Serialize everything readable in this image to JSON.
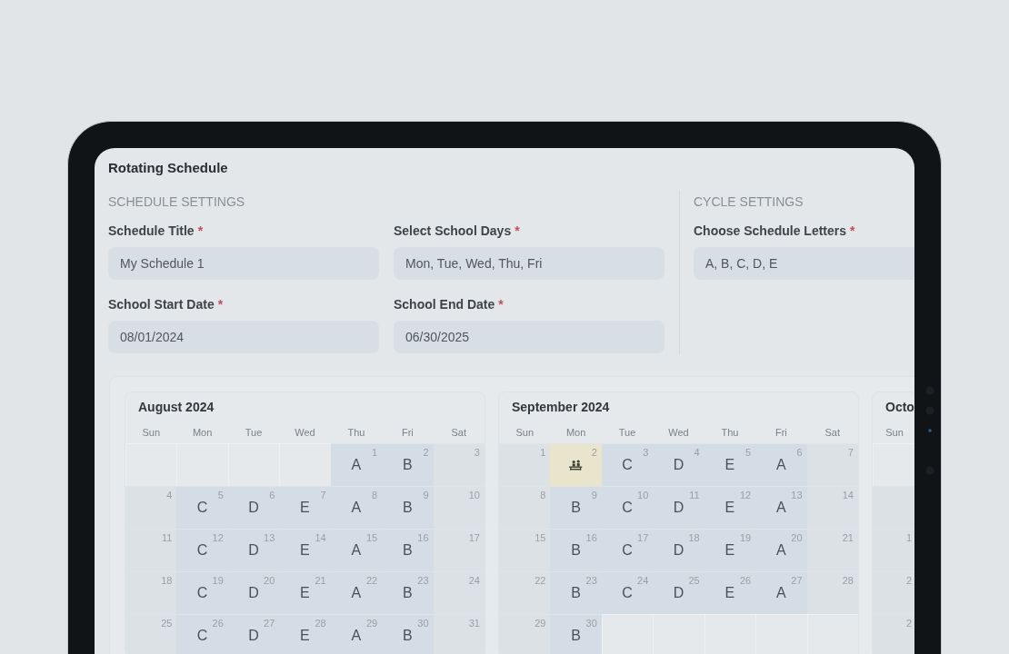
{
  "title": "Rotating Schedule",
  "schedule_settings": {
    "heading": "SCHEDULE SETTINGS",
    "fields": [
      {
        "label": "Schedule Title",
        "mark": "*",
        "value": "My Schedule 1"
      },
      {
        "label": "Select School Days",
        "mark": "*",
        "value": "Mon, Tue, Wed, Thu, Fri"
      },
      {
        "label": "School Start Date",
        "mark": "*",
        "value": "08/01/2024"
      },
      {
        "label": "School End Date",
        "mark": "*",
        "value": "06/30/2025"
      }
    ]
  },
  "cycle_settings": {
    "heading": "CYCLE SETTINGS",
    "fields": [
      {
        "label": "Choose Schedule Letters",
        "mark": "*",
        "value": "A, B, C, D, E"
      }
    ]
  },
  "months": [
    {
      "title": "August 2024",
      "weekdays": [
        "Sun",
        "Mon",
        "Tue",
        "Wed",
        "Thu",
        "Fri",
        "Sat"
      ],
      "weeks": [
        [
          {
            "kind": "blank"
          },
          {
            "kind": "blank"
          },
          {
            "kind": "blank"
          },
          {
            "kind": "blank"
          },
          {
            "kind": "school",
            "day": "1",
            "letter": "A"
          },
          {
            "kind": "school",
            "day": "2",
            "letter": "B"
          },
          {
            "kind": "weekend",
            "day": "3"
          }
        ],
        [
          {
            "kind": "weekend",
            "day": "4"
          },
          {
            "kind": "school",
            "day": "5",
            "letter": "C"
          },
          {
            "kind": "school",
            "day": "6",
            "letter": "D"
          },
          {
            "kind": "school",
            "day": "7",
            "letter": "E"
          },
          {
            "kind": "school",
            "day": "8",
            "letter": "A"
          },
          {
            "kind": "school",
            "day": "9",
            "letter": "B"
          },
          {
            "kind": "weekend",
            "day": "10"
          }
        ],
        [
          {
            "kind": "weekend",
            "day": "11"
          },
          {
            "kind": "school",
            "day": "12",
            "letter": "C"
          },
          {
            "kind": "school",
            "day": "13",
            "letter": "D"
          },
          {
            "kind": "school",
            "day": "14",
            "letter": "E"
          },
          {
            "kind": "school",
            "day": "15",
            "letter": "A"
          },
          {
            "kind": "school",
            "day": "16",
            "letter": "B"
          },
          {
            "kind": "weekend",
            "day": "17"
          }
        ],
        [
          {
            "kind": "weekend",
            "day": "18"
          },
          {
            "kind": "school",
            "day": "19",
            "letter": "C"
          },
          {
            "kind": "school",
            "day": "20",
            "letter": "D"
          },
          {
            "kind": "school",
            "day": "21",
            "letter": "E"
          },
          {
            "kind": "school",
            "day": "22",
            "letter": "A"
          },
          {
            "kind": "school",
            "day": "23",
            "letter": "B"
          },
          {
            "kind": "weekend",
            "day": "24"
          }
        ],
        [
          {
            "kind": "weekend",
            "day": "25"
          },
          {
            "kind": "school",
            "day": "26",
            "letter": "C"
          },
          {
            "kind": "school",
            "day": "27",
            "letter": "D"
          },
          {
            "kind": "school",
            "day": "28",
            "letter": "E"
          },
          {
            "kind": "school",
            "day": "29",
            "letter": "A"
          },
          {
            "kind": "school",
            "day": "30",
            "letter": "B"
          },
          {
            "kind": "weekend",
            "day": "31"
          }
        ]
      ]
    },
    {
      "title": "September 2024",
      "weekdays": [
        "Sun",
        "Mon",
        "Tue",
        "Wed",
        "Thu",
        "Fri",
        "Sat"
      ],
      "weeks": [
        [
          {
            "kind": "weekend",
            "day": "1"
          },
          {
            "kind": "holiday",
            "day": "2"
          },
          {
            "kind": "school",
            "day": "3",
            "letter": "C"
          },
          {
            "kind": "school",
            "day": "4",
            "letter": "D"
          },
          {
            "kind": "school",
            "day": "5",
            "letter": "E"
          },
          {
            "kind": "school",
            "day": "6",
            "letter": "A"
          },
          {
            "kind": "weekend",
            "day": "7"
          }
        ],
        [
          {
            "kind": "weekend",
            "day": "8"
          },
          {
            "kind": "school",
            "day": "9",
            "letter": "B"
          },
          {
            "kind": "school",
            "day": "10",
            "letter": "C"
          },
          {
            "kind": "school",
            "day": "11",
            "letter": "D"
          },
          {
            "kind": "school",
            "day": "12",
            "letter": "E"
          },
          {
            "kind": "school",
            "day": "13",
            "letter": "A"
          },
          {
            "kind": "weekend",
            "day": "14"
          }
        ],
        [
          {
            "kind": "weekend",
            "day": "15"
          },
          {
            "kind": "school",
            "day": "16",
            "letter": "B"
          },
          {
            "kind": "school",
            "day": "17",
            "letter": "C"
          },
          {
            "kind": "school",
            "day": "18",
            "letter": "D"
          },
          {
            "kind": "school",
            "day": "19",
            "letter": "E"
          },
          {
            "kind": "school",
            "day": "20",
            "letter": "A"
          },
          {
            "kind": "weekend",
            "day": "21"
          }
        ],
        [
          {
            "kind": "weekend",
            "day": "22"
          },
          {
            "kind": "school",
            "day": "23",
            "letter": "B"
          },
          {
            "kind": "school",
            "day": "24",
            "letter": "C"
          },
          {
            "kind": "school",
            "day": "25",
            "letter": "D"
          },
          {
            "kind": "school",
            "day": "26",
            "letter": "E"
          },
          {
            "kind": "school",
            "day": "27",
            "letter": "A"
          },
          {
            "kind": "weekend",
            "day": "28"
          }
        ],
        [
          {
            "kind": "weekend",
            "day": "29"
          },
          {
            "kind": "school",
            "day": "30",
            "letter": "B"
          },
          {
            "kind": "blank"
          },
          {
            "kind": "blank"
          },
          {
            "kind": "blank"
          },
          {
            "kind": "blank"
          },
          {
            "kind": "blank"
          }
        ]
      ]
    },
    {
      "title": "Octo",
      "weekdays": [
        "Sun"
      ],
      "weeks": [
        [
          {
            "kind": "blank"
          }
        ],
        [
          {
            "kind": "weekend"
          }
        ],
        [
          {
            "kind": "weekend",
            "day": "1"
          }
        ],
        [
          {
            "kind": "weekend",
            "day": "2"
          }
        ],
        [
          {
            "kind": "weekend",
            "day": "2"
          }
        ]
      ]
    }
  ]
}
